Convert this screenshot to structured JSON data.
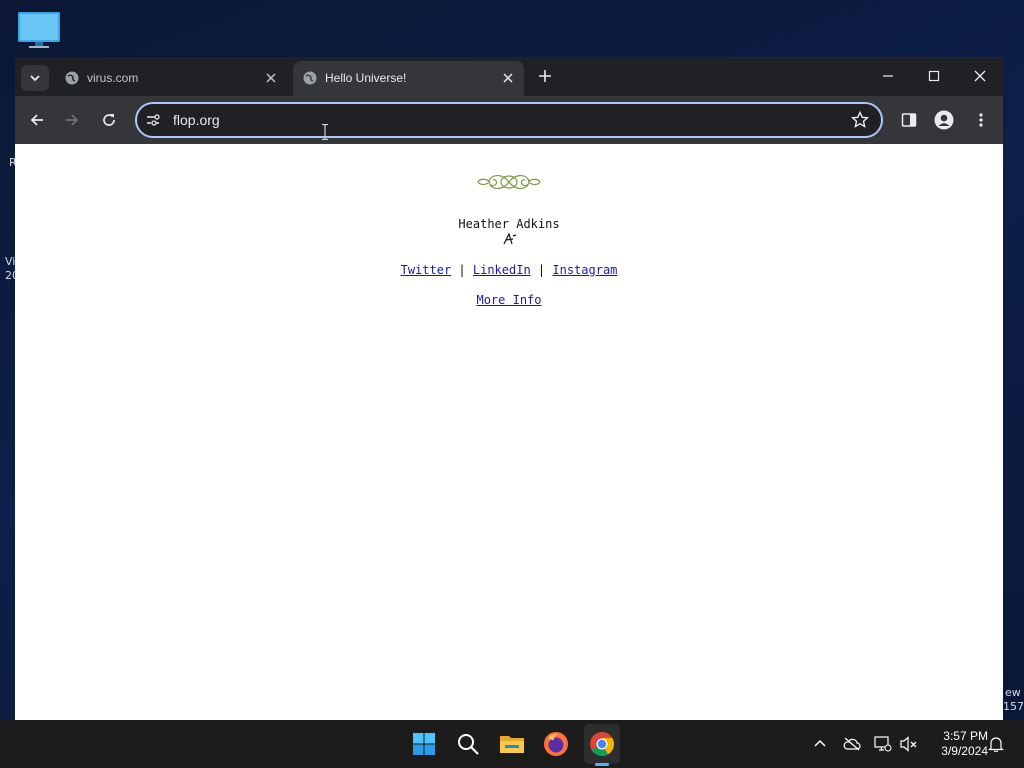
{
  "desktop": {
    "edge_labels": [
      "R",
      "Vi",
      "20",
      "ew",
      "157"
    ]
  },
  "browser": {
    "tabs": [
      {
        "title": "virus.com",
        "active": false
      },
      {
        "title": "Hello Universe!",
        "active": true
      }
    ],
    "address_bar": {
      "value": "flop.org"
    }
  },
  "page": {
    "name": "Heather Adkins",
    "links": [
      "Twitter",
      "LinkedIn",
      "Instagram"
    ],
    "separator": "|",
    "more_info": "More Info"
  },
  "taskbar": {
    "apps": [
      "start-icon",
      "search-icon",
      "file-explorer-icon",
      "firefox-icon",
      "chrome-icon"
    ],
    "clock": {
      "time": "3:57 PM",
      "date": "3/9/2024"
    }
  },
  "colors": {
    "tab_strip": "#202124",
    "toolbar": "#35363a",
    "omnibox_border": "#a8c7fa",
    "link": "#1a1aa6",
    "taskbar": "#1c1c1c"
  }
}
